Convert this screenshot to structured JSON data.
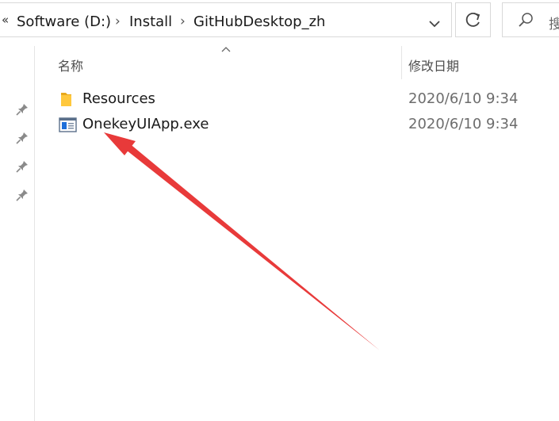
{
  "address_bar": {
    "overflow_glyph": "«",
    "crumbs": [
      "Software (D:)",
      "Install",
      "GitHubDesktop_zh"
    ],
    "separator": "›",
    "dropdown_icon": "chevron-down-icon",
    "refresh_icon": "refresh-icon"
  },
  "search": {
    "icon": "search-icon",
    "placeholder": "搜"
  },
  "nav_pane": {
    "pins": [
      "pin-icon",
      "pin-icon",
      "pin-icon",
      "pin-icon"
    ]
  },
  "columns": {
    "name": "名称",
    "date_modified": "修改日期"
  },
  "files": [
    {
      "name": "Resources",
      "date": "2020/6/10 9:34",
      "icon": "folder-icon"
    },
    {
      "name": "OnekeyUIApp.exe",
      "date": "2020/6/10 9:34",
      "icon": "exe-icon"
    }
  ],
  "colors": {
    "folder": "#ffc83d",
    "exe_accent": "#1e6fd9",
    "annotation_arrow": "#e83a3a"
  }
}
